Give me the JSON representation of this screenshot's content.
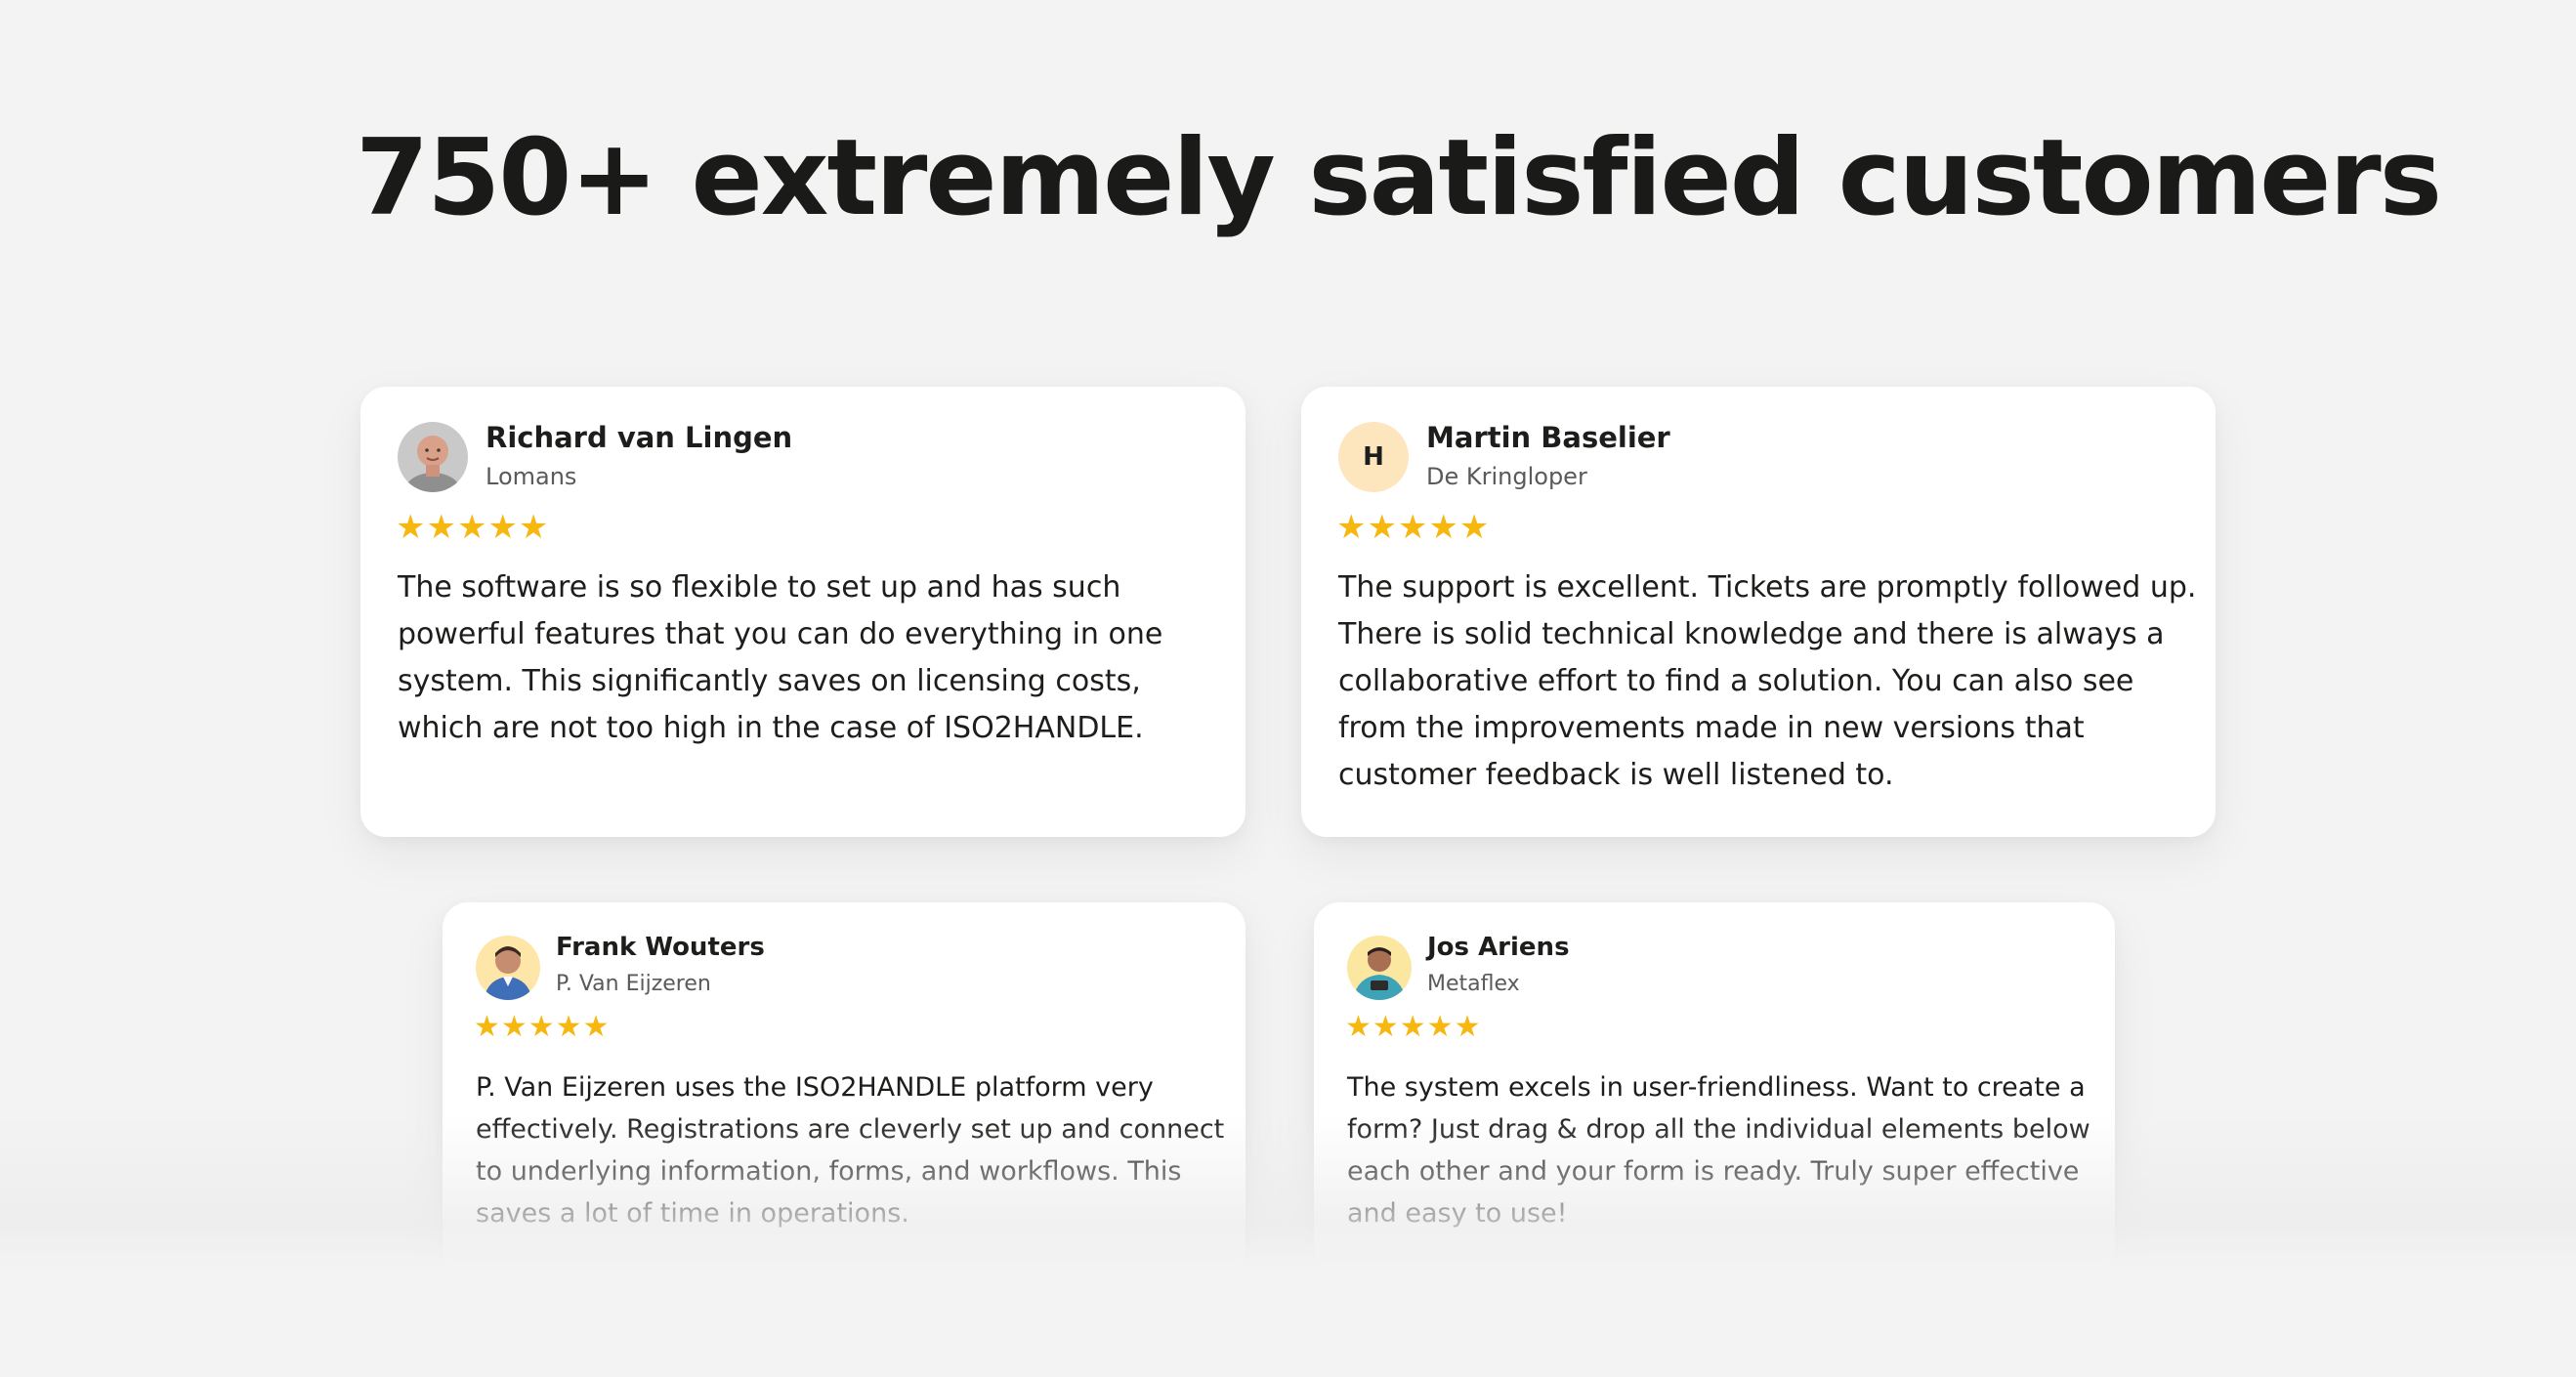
{
  "heading": "750+ extremely satisfied customers",
  "colors": {
    "background": "#f3f3f3",
    "card": "#ffffff",
    "star": "#f6b70e",
    "text": "#1d1d1b",
    "muted": "#5a5a5a",
    "avatar_letter_bg": "#fde6bd"
  },
  "testimonials": [
    {
      "name": "Richard van Lingen",
      "company": "Lomans",
      "avatar": "person-photo-icon",
      "rating": 5,
      "stars": "★★★★★",
      "quote": "The software is so flexible to set up and has such powerful features that you can do everything in one system. This significantly saves on licensing costs, which are not too high in the case of ISO2HANDLE."
    },
    {
      "name": "Martin Baselier",
      "company": "De Kringloper",
      "avatar_letter": "H",
      "rating": 5,
      "stars": "★★★★★",
      "quote": "The support is excellent. Tickets are promptly followed up. There is solid technical knowledge and there is always a collaborative effort to find a solution. You can also see from the improvements made in new versions that customer feedback is well listened to."
    },
    {
      "name": "Frank Wouters",
      "company": "P. Van Eijzeren",
      "avatar": "person-photo-icon",
      "rating": 5,
      "stars": "★★★★★",
      "quote": "P. Van Eijzeren uses the ISO2HANDLE platform very effectively. Registrations are cleverly set up and connect to underlying information, forms, and workflows. This saves a lot of time in operations."
    },
    {
      "name": "Jos Ariens",
      "company": "Metaflex",
      "avatar": "person-photo-icon",
      "rating": 5,
      "stars": "★★★★★",
      "quote": "The system excels in user-friendliness. Want to create a form? Just drag & drop all the individual elements below each other and your form is ready. Truly super effective and easy to use!"
    }
  ]
}
